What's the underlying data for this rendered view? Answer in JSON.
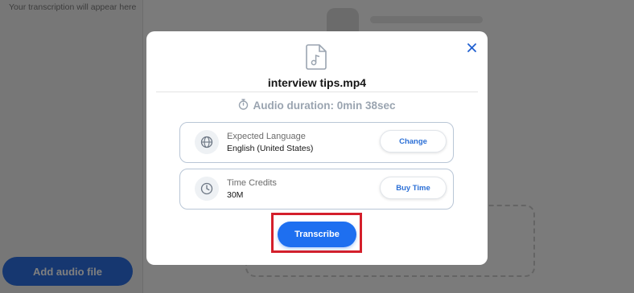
{
  "background": {
    "transcription_hint": "Your transcription will appear here",
    "add_audio_label": "Add audio file"
  },
  "modal": {
    "file_name": "interview tips.mp4",
    "file_icon": "audio-file-icon",
    "close_icon": "close-icon",
    "duration_icon": "stopwatch-icon",
    "duration_text": "Audio duration: 0min 38sec",
    "language": {
      "icon": "globe-icon",
      "title": "Expected Language",
      "value": "English (United States)",
      "button_label": "Change"
    },
    "credits": {
      "icon": "clock-icon",
      "title": "Time Credits",
      "value": "30M",
      "button_label": "Buy Time"
    },
    "transcribe_label": "Transcribe"
  },
  "colors": {
    "accent": "#1e6ff0",
    "highlight": "#d41f2b",
    "card_border": "#b9c6d6",
    "muted_text": "#9aa4b0"
  }
}
